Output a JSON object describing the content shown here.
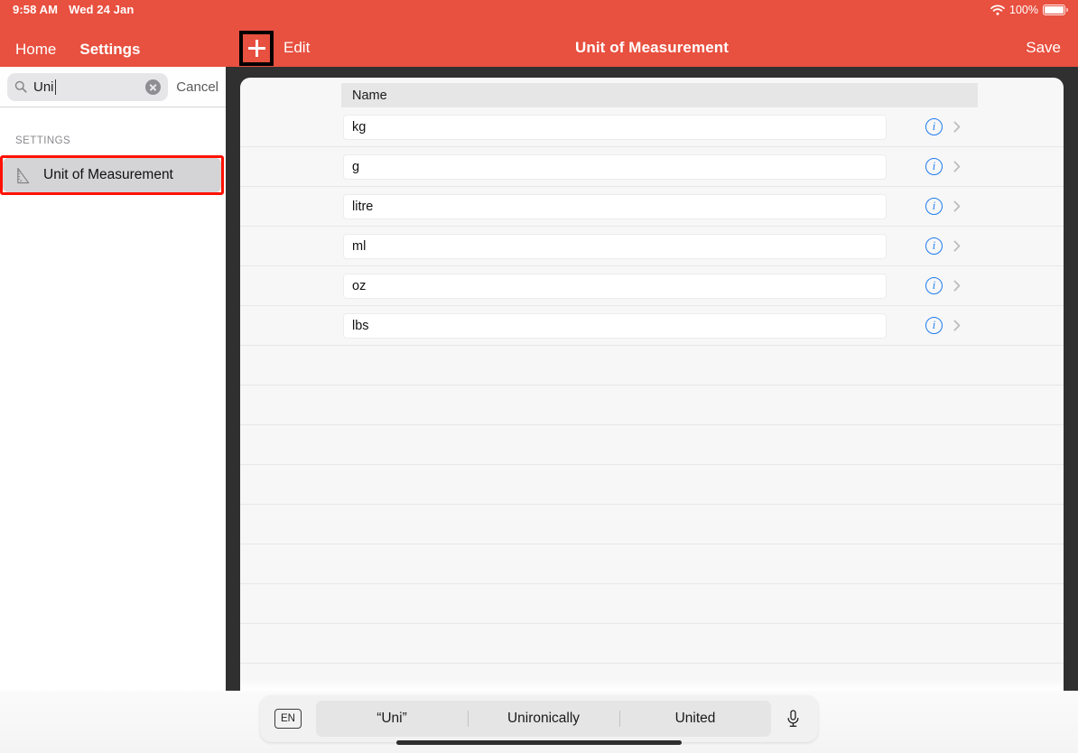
{
  "status_bar": {
    "time": "9:58 AM",
    "date": "Wed 24 Jan",
    "battery_percent": "100%",
    "wifi_icon": "wifi-icon",
    "battery_icon": "battery-icon"
  },
  "sidebar": {
    "back_label": "Home",
    "title": "Settings",
    "search": {
      "value": "Uni",
      "icon": "search-icon",
      "clear_icon": "clear-circle-icon",
      "cancel_label": "Cancel"
    },
    "section_label": "SETTINGS",
    "items": [
      {
        "label": "Unit of Measurement",
        "icon": "ruler-triangle-icon",
        "selected": true,
        "highlighted": true
      }
    ]
  },
  "topbar": {
    "add_icon": "plus-icon",
    "add_highlighted": true,
    "edit_label": "Edit",
    "title": "Unit of Measurement",
    "save_label": "Save"
  },
  "table": {
    "columns": [
      "Name"
    ],
    "rows": [
      {
        "name": "kg",
        "info_icon": "info-circle-icon",
        "chevron_icon": "chevron-right-icon"
      },
      {
        "name": "g",
        "info_icon": "info-circle-icon",
        "chevron_icon": "chevron-right-icon"
      },
      {
        "name": "litre",
        "info_icon": "info-circle-icon",
        "chevron_icon": "chevron-right-icon"
      },
      {
        "name": "ml",
        "info_icon": "info-circle-icon",
        "chevron_icon": "chevron-right-icon"
      },
      {
        "name": "oz",
        "info_icon": "info-circle-icon",
        "chevron_icon": "chevron-right-icon"
      },
      {
        "name": "lbs",
        "info_icon": "info-circle-icon",
        "chevron_icon": "chevron-right-icon"
      }
    ],
    "empty_row_count": 9
  },
  "keyboard": {
    "language_key": "EN",
    "suggestions": [
      "“Uni”",
      "Unironically",
      "United"
    ],
    "mic_icon": "microphone-icon"
  },
  "colors": {
    "accent_red": "#e8503f",
    "highlight_red": "#ff1100",
    "info_blue": "#1e7bf0",
    "card_bg": "#f7f7f7",
    "device_bg": "#303030"
  }
}
